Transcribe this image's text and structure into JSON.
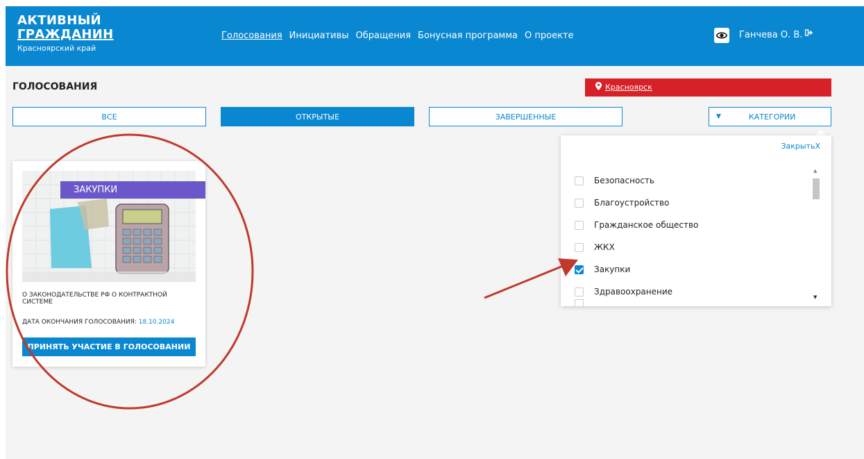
{
  "header": {
    "logo_line1": "АКТИВНЫЙ",
    "logo_line2": "ГРАЖДАНИН",
    "logo_sub": "Красноярский край",
    "nav": [
      "Голосования",
      "Инициативы",
      "Обращения",
      "Бонусная программа",
      "О проекте"
    ],
    "active_nav": "Голосования",
    "user_name": "Ганчева О. В.",
    "accessibility_icon": "eye-icon",
    "logout_icon": "logout-icon"
  },
  "page": {
    "title": "ГОЛОСОВАНИЯ",
    "city": "Красноярск"
  },
  "tabs": {
    "all": "ВСЕ",
    "open": "ОТКРЫТЫЕ",
    "done": "ЗАВЕРШЕННЫЕ",
    "categories": "КАТЕГОРИИ",
    "active": "ОТКРЫТЫЕ"
  },
  "categories_dropdown": {
    "close_label": "Закрыть",
    "close_icon": "X",
    "items": [
      {
        "label": "Безопасность",
        "checked": false
      },
      {
        "label": "Благоустройство",
        "checked": false
      },
      {
        "label": "Гражданское общество",
        "checked": false
      },
      {
        "label": "ЖКХ",
        "checked": false
      },
      {
        "label": "Закупки",
        "checked": true
      },
      {
        "label": "Здравоохранение",
        "checked": false
      }
    ]
  },
  "card": {
    "category": "ЗАКУПКИ",
    "title": "О ЗАКОНОДАТЕЛЬСТВЕ РФ О КОНТРАКТНОЙ СИСТЕМЕ",
    "date_label": "ДАТА ОКОНЧАНИЯ ГОЛОСОВАНИЯ:",
    "date_value": "18.10.2024",
    "button": "ПРИНЯТЬ УЧАСТИЕ В ГОЛОСОВАНИИ"
  },
  "colors": {
    "header": "#0a87d1",
    "city_bar": "#d52127",
    "badge": "#6b57c9",
    "annotation": "#c0392b"
  }
}
